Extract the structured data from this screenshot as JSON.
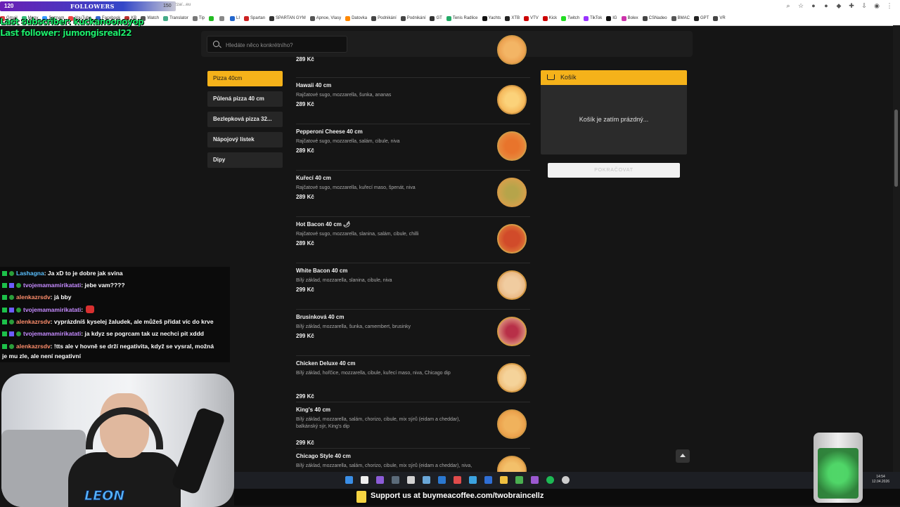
{
  "browser": {
    "url_fragment": "ozdova/nabidka/pizza/...eu",
    "bookmarks": [
      "Gmail",
      "Mapy",
      "Seznam",
      "YouTube",
      "Facebook",
      "KB",
      "Watch",
      "Translator",
      "Tip",
      "",
      "",
      "LI",
      "Spartan",
      "SPARTAN GYM",
      "Apnoe, Vlasy",
      "Datovka",
      "Podnikání",
      "Podnikání",
      "GT",
      "Tenis Radlice",
      "Yachts",
      "XTB",
      "VTV",
      "Kick",
      "Twitch",
      "TikTok",
      "IG",
      "Bolex",
      "CSNadeo",
      "BMAC",
      "GPT",
      "VR"
    ]
  },
  "stream": {
    "followers_count": "120",
    "followers_label": "FOLLOWERS",
    "followers_goal": "150",
    "last_subscriber": "Last subscriber: kuckanoonoyop",
    "last_follower": "Last follower: jumongisreal22",
    "webcam_label": "LEON",
    "banner_text": "Support us at buymeacoffee.com/twobraincellz"
  },
  "chat": [
    {
      "user": "Lashagna",
      "msg": ": Ja xD to je dobre jak svina",
      "badges": 2,
      "color": "u1"
    },
    {
      "user": "tvojemamamirikatati",
      "msg": ": jebe vam????",
      "badges": 3,
      "color": "u2"
    },
    {
      "user": "alenkazrsdv",
      "msg": ": já bby",
      "badges": 2,
      "color": "u3"
    },
    {
      "user": "tvojemamamirikatati",
      "msg": ":",
      "badges": 3,
      "color": "u2",
      "emote": true
    },
    {
      "user": "alenkazrsdv",
      "msg": ": vyprázdníš kyselej žaludek, ale můžeš přidat víc do krve",
      "badges": 2,
      "color": "u3"
    },
    {
      "user": "tvojemamamirikatati",
      "msg": ": ja kdyz se pogrcam tak uz nechci pit xddd",
      "badges": 3,
      "color": "u2"
    },
    {
      "user": "alenkazrsdv",
      "msg": ": !tts ale v hovně se drží negativita, když se vysral, možná",
      "badges": 2,
      "color": "u3"
    },
    {
      "user": "",
      "msg": "je mu zle, ale není negativní",
      "badges": 0,
      "color": "u3"
    }
  ],
  "site": {
    "search_placeholder": "Hledáte něco konkrétního?",
    "categories": [
      {
        "label": "Pizza 40cm",
        "active": true
      },
      {
        "label": "Půlená pizza 40 cm",
        "active": false
      },
      {
        "label": "Bezlepková pizza 32...",
        "active": false
      },
      {
        "label": "Nápojový lístek",
        "active": false
      },
      {
        "label": "Dipy",
        "active": false
      }
    ],
    "top_partial_price": "289 Kč",
    "items": [
      {
        "name": "Hawaii 40 cm",
        "desc": "Rajčatové sugo, mozzarella, šunka, ananas",
        "price": "289 Kč"
      },
      {
        "name": "Pepperoni Cheese 40 cm",
        "desc": "Rajčatové sugo, mozzarella, salám, cibule, niva",
        "price": "289 Kč"
      },
      {
        "name": "Kuřecí 40 cm",
        "desc": "Rajčatové sugo, mozzarella, kuřecí maso, špenát, niva",
        "price": "289 Kč"
      },
      {
        "name": "Hot Bacon 40 cm 🌶",
        "desc": "Rajčatové sugo, mozzarella, slanina, salám, cibule, chilli",
        "price": "289 Kč"
      },
      {
        "name": "White Bacon 40 cm",
        "desc": "Bílý základ, mozzarella, slanina, cibule, niva",
        "price": "299 Kč"
      },
      {
        "name": "Brusinková 40 cm",
        "desc": "Bílý základ, mozzarella, šunka, camembert, brusinky",
        "price": "299 Kč"
      },
      {
        "name": "Chicken Deluxe 40 cm",
        "desc": "Bílý základ, hořčice, mozzarella, cibule, kuřecí maso, niva, Chicago dip",
        "price": "299 Kč"
      },
      {
        "name": "King's 40 cm",
        "desc": "Bílý základ, mozzarella, salám, chorizo, cibule, mix sýrů (eidam a cheddar), balkánský sýr, King's dip",
        "price": "299 Kč"
      },
      {
        "name": "Chicago Style 40 cm",
        "desc": "Bílý základ, mozzarella, salám, chorizo, cibule, mix sýrů (eidam a cheddar), niva,",
        "price": ""
      }
    ],
    "cart": {
      "title": "Košík",
      "empty_text": "Košík je zatím prázdný...",
      "continue_label": "POKRAČOVAT"
    }
  },
  "taskbar": {
    "time": "14:54",
    "date": "12.04.2026"
  },
  "colors": {
    "accent": "#f5b21a",
    "background": "#151515",
    "overlay_green": "#1de86a"
  }
}
